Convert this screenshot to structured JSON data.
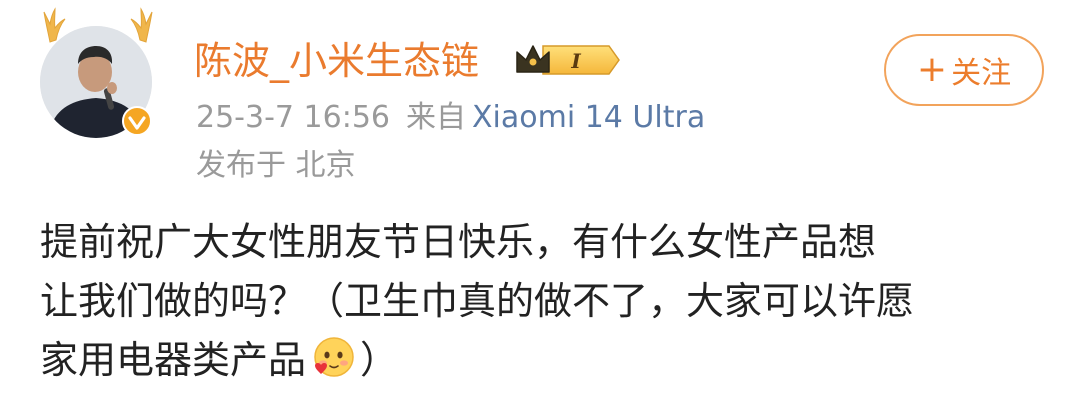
{
  "post": {
    "author": {
      "name": "陈波_小米生态链",
      "avatar_icon": "avatar-man-with-microphone",
      "verified_icon": "verified-badge-icon",
      "vip_level": "I"
    },
    "timestamp": "25-3-7 16:56",
    "source_prefix": "来自",
    "device": "Xiaomi 14 Ultra",
    "location": "发布于 北京",
    "follow_label": "关注",
    "content": {
      "line1": "提前祝广大女性朋友节日快乐，有什么女性产品想",
      "line2": "让我们做的吗？（卫生巾真的做不了，大家可以许愿",
      "line3": "家用电器类产品",
      "line3_end": "）"
    }
  },
  "colors": {
    "username": "#ea7b2e",
    "device": "#5b7aa6",
    "meta": "#9a9a9a",
    "follow": "#ec7d2c",
    "body": "#222222"
  }
}
